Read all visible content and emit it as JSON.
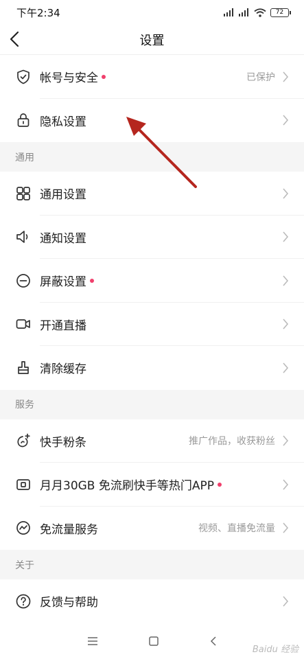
{
  "status_bar": {
    "time": "下午2:34",
    "battery": "72"
  },
  "header": {
    "title": "设置"
  },
  "rows_top": [
    {
      "label": "帐号与安全",
      "value": "已保护",
      "badge": true
    },
    {
      "label": "隐私设置",
      "value": "",
      "badge": false
    }
  ],
  "sections": [
    {
      "title": "通用",
      "rows": [
        {
          "label": "通用设置",
          "value": "",
          "badge": false
        },
        {
          "label": "通知设置",
          "value": "",
          "badge": false
        },
        {
          "label": "屏蔽设置",
          "value": "",
          "badge": true
        },
        {
          "label": "开通直播",
          "value": "",
          "badge": false
        },
        {
          "label": "清除缓存",
          "value": "",
          "badge": false
        }
      ]
    },
    {
      "title": "服务",
      "rows": [
        {
          "label": "快手粉条",
          "value": "推广作品，收获粉丝",
          "badge": false
        },
        {
          "label": "月月30GB 免流刷快手等热门APP",
          "value": "",
          "badge": true
        },
        {
          "label": "免流量服务",
          "value": "视频、直播免流量",
          "badge": false
        }
      ]
    },
    {
      "title": "关于",
      "rows": [
        {
          "label": "反馈与帮助",
          "value": "",
          "badge": false
        }
      ]
    }
  ],
  "watermark": "Baidu 经验",
  "colors": {
    "badge": "#f0406c",
    "arrow": "#b5261e",
    "section_bg": "#f5f5f5"
  }
}
